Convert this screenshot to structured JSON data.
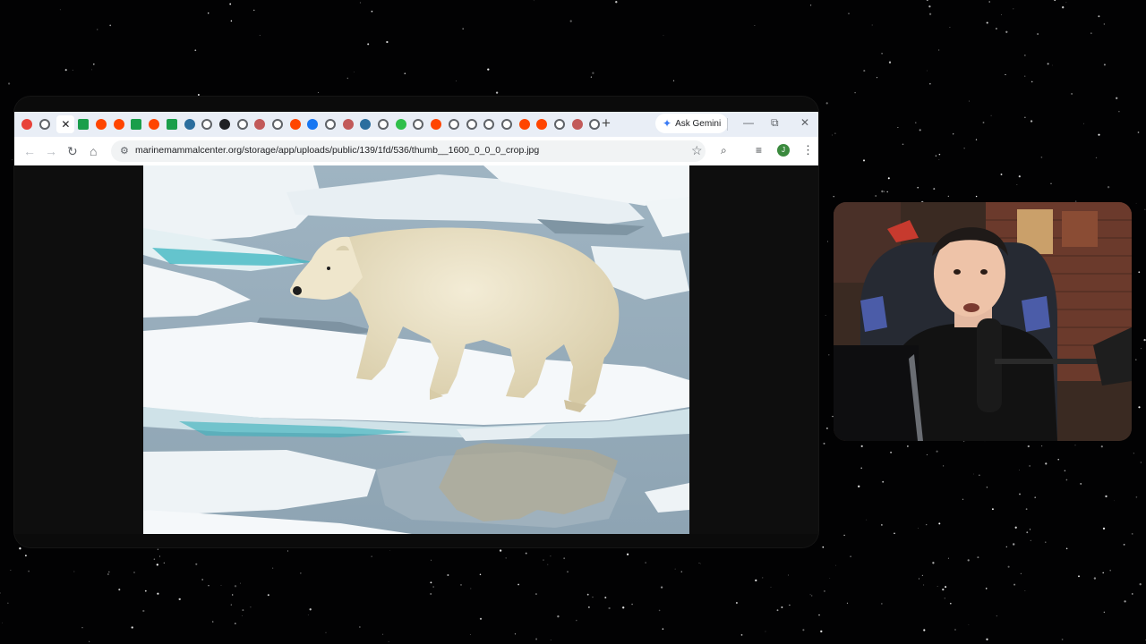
{
  "browser": {
    "tabs": [
      {
        "icon": "grid-icon",
        "color": "#e8423a"
      },
      {
        "icon": "globe-icon",
        "color": "#5f6368"
      },
      {
        "icon": "close-icon",
        "active": true,
        "label": "✕"
      },
      {
        "icon": "zillow-icon",
        "color": "#1a9e4b"
      },
      {
        "icon": "reddit-icon",
        "color": "#ff4500"
      },
      {
        "icon": "reddit-icon",
        "color": "#ff4500"
      },
      {
        "icon": "zillow-icon",
        "color": "#1a9e4b"
      },
      {
        "icon": "reddit-icon",
        "color": "#ff4500"
      },
      {
        "icon": "zillow-icon",
        "color": "#1a9e4b"
      },
      {
        "icon": "timer-icon",
        "color": "#2b6e9e"
      },
      {
        "icon": "globe-icon",
        "color": "#5f6368"
      },
      {
        "icon": "dark-circle-icon",
        "color": "#202124"
      },
      {
        "icon": "globe-icon",
        "color": "#5f6368"
      },
      {
        "icon": "palette-icon",
        "color": "#c25a5a"
      },
      {
        "icon": "globe-icon",
        "color": "#5f6368"
      },
      {
        "icon": "reddit-icon",
        "color": "#ff4500"
      },
      {
        "icon": "facebook-icon",
        "color": "#1877f2"
      },
      {
        "icon": "globe-icon",
        "color": "#5f6368"
      },
      {
        "icon": "palette-icon",
        "color": "#c25a5a"
      },
      {
        "icon": "timer-icon",
        "color": "#2b6e9e"
      },
      {
        "icon": "globe-icon",
        "color": "#5f6368"
      },
      {
        "icon": "green-dot-icon",
        "color": "#2fbf4a"
      },
      {
        "icon": "globe-icon",
        "color": "#5f6368"
      },
      {
        "icon": "reddit-icon",
        "color": "#ff4500"
      },
      {
        "icon": "globe-icon",
        "color": "#5f6368"
      },
      {
        "icon": "globe-icon",
        "color": "#5f6368"
      },
      {
        "icon": "globe-icon",
        "color": "#5f6368"
      },
      {
        "icon": "globe-icon",
        "color": "#5f6368"
      },
      {
        "icon": "reddit-icon",
        "color": "#ff4500"
      },
      {
        "icon": "reddit-icon",
        "color": "#ff4500"
      },
      {
        "icon": "globe-icon",
        "color": "#5f6368"
      },
      {
        "icon": "palette-icon",
        "color": "#c25a5a"
      },
      {
        "icon": "globe-icon",
        "color": "#5f6368"
      }
    ],
    "new_tab_label": "+",
    "gemini_label": "Ask Gemini",
    "gemini_icon": "✦",
    "minimize_label": "—",
    "restore_label": "⧉",
    "close_label": "✕",
    "url": "marinemammalcenter.org/storage/app/uploads/public/139/1fd/536/thumb__1600_0_0_0_crop.jpg",
    "profile_initial": "J",
    "icons": {
      "back": "←",
      "forward": "→",
      "reload": "↻",
      "home": "⌂",
      "site_info": "⚙",
      "bookmark": "☆",
      "lens": "⌕",
      "media": "≡",
      "menu": "⋮"
    }
  }
}
